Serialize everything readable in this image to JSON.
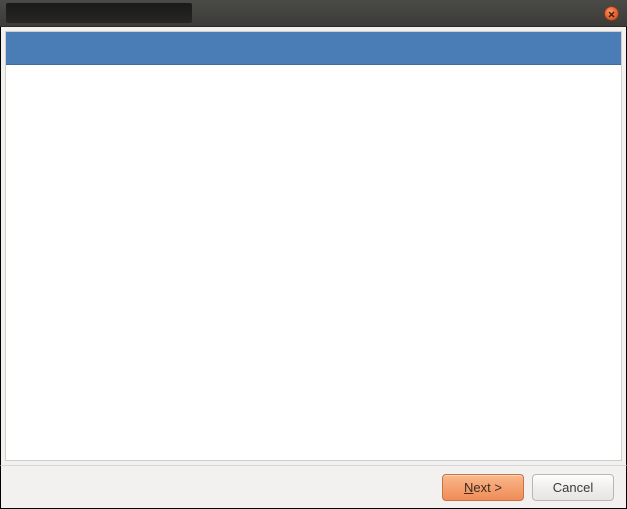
{
  "titlebar": {
    "title": ""
  },
  "buttons": {
    "next": {
      "mnemonic": "N",
      "rest": "ext >"
    },
    "cancel": "Cancel"
  },
  "colors": {
    "accent": "#f5a172",
    "banner": "#4a7cb5"
  }
}
